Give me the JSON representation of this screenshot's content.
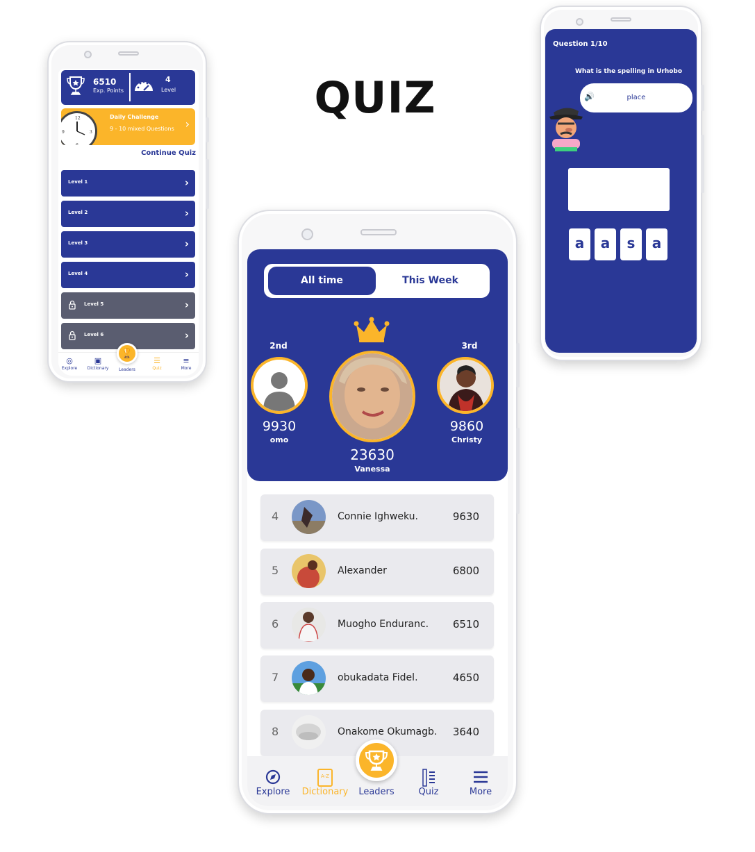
{
  "page_title": "QUIZ",
  "colors": {
    "primary": "#2a3896",
    "accent": "#fbb52a",
    "locked": "#5a5d70"
  },
  "quiz_home": {
    "stats": {
      "points_value": "6510",
      "points_label": "Exp. Points",
      "level_value": "4",
      "level_label": "Level"
    },
    "daily_challenge": {
      "title": "Daily Challenge",
      "subtitle": "9 - 10 mixed Questions"
    },
    "continue_label": "Continue Quiz",
    "levels": [
      {
        "label": "Level 1",
        "locked": false
      },
      {
        "label": "Level 2",
        "locked": false
      },
      {
        "label": "Level 3",
        "locked": false
      },
      {
        "label": "Level 4",
        "locked": false
      },
      {
        "label": "Level 5",
        "locked": true
      },
      {
        "label": "Level 6",
        "locked": true
      }
    ],
    "nav": [
      {
        "label": "Explore",
        "icon": "compass-icon"
      },
      {
        "label": "Dictionary",
        "icon": "book-icon"
      },
      {
        "label": "Leaders",
        "icon": "trophy-icon"
      },
      {
        "label": "Quiz",
        "icon": "list-icon",
        "active": true
      },
      {
        "label": "More",
        "icon": "menu-icon"
      }
    ]
  },
  "question": {
    "counter": "Question 1/10",
    "prompt": "What is the spelling in Urhobo",
    "word": "place",
    "letters": [
      "a",
      "a",
      "s",
      "a"
    ]
  },
  "leaderboard": {
    "tabs": {
      "active": "All time",
      "other": "This Week"
    },
    "podium": {
      "first": {
        "score": "23630",
        "name": "Vanessa"
      },
      "second": {
        "rank": "2nd",
        "score": "9930",
        "name": "omo"
      },
      "third": {
        "rank": "3rd",
        "score": "9860",
        "name": "Christy"
      }
    },
    "rows": [
      {
        "rank": "4",
        "name": "Connie  Ighweku.",
        "score": "9630"
      },
      {
        "rank": "5",
        "name": "Alexander",
        "score": "6800"
      },
      {
        "rank": "6",
        "name": "Muogho Enduranc.",
        "score": "6510"
      },
      {
        "rank": "7",
        "name": "obukadata Fidel.",
        "score": "4650"
      },
      {
        "rank": "8",
        "name": "Onakome Okumagb.",
        "score": "3640"
      }
    ],
    "nav": [
      {
        "label": "Explore",
        "icon": "compass-icon"
      },
      {
        "label": "Dictionary",
        "icon": "book-icon",
        "active": true
      },
      {
        "label": "Leaders",
        "icon": "trophy-icon"
      },
      {
        "label": "Quiz",
        "icon": "list-icon"
      },
      {
        "label": "More",
        "icon": "menu-icon"
      }
    ]
  }
}
